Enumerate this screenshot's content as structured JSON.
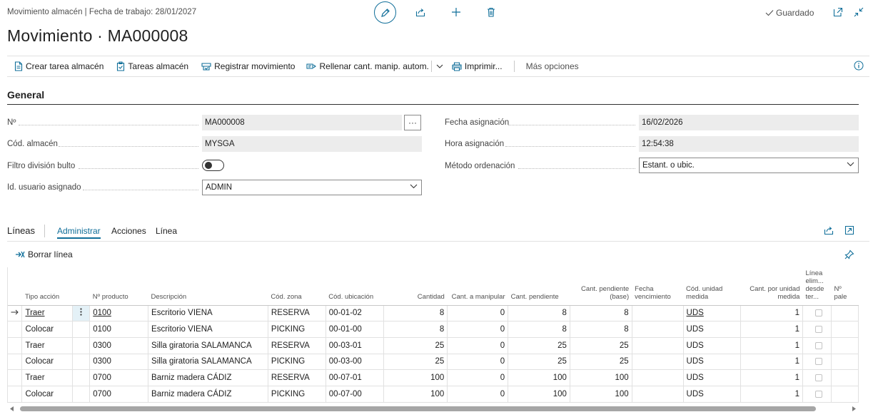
{
  "header": {
    "breadcrumb": "Movimiento almacén | Fecha de trabajo: 28/01/2027",
    "title": "Movimiento · MA000008",
    "saved_label": "Guardado"
  },
  "actions": {
    "create_task": "Crear tarea almacén",
    "tasks": "Tareas almacén",
    "register": "Registrar movimiento",
    "autofill": "Rellenar cant. manip. autom.",
    "print": "Imprimir...",
    "more": "Más opciones"
  },
  "general": {
    "title": "General",
    "no_label": "Nº",
    "no_value": "MA000008",
    "location_label": "Cód. almacén",
    "location_value": "MYSGA",
    "breakbulk_label": "Filtro división bulto",
    "breakbulk_value": false,
    "user_label": "Id. usuario asignado",
    "user_value": "ADMIN",
    "assign_date_label": "Fecha asignación",
    "assign_date_value": "16/02/2026",
    "assign_time_label": "Hora asignación",
    "assign_time_value": "12:54:38",
    "sort_label": "Método ordenación",
    "sort_value": "Estant. o ubic.",
    "assist_label": "···"
  },
  "lines": {
    "title": "Líneas",
    "tabs": [
      "Administrar",
      "Acciones",
      "Línea"
    ],
    "delete_label": "Borrar línea",
    "columns": {
      "action_type": "Tipo acción",
      "item_no": "Nº producto",
      "description": "Descripción",
      "zone": "Cód. zona",
      "bin": "Cód. ubicación",
      "qty": "Cantidad",
      "qty_handle": "Cant. a manipular",
      "qty_outstanding": "Cant. pendiente",
      "qty_outstanding_base": "Cant. pendiente (base)",
      "expiration": "Fecha vencimiento",
      "uom": "Cód. unidad medida",
      "qty_per_uom": "Cant. por unidad medida",
      "breakbulk_line": "Línea elim... desde ter...",
      "pallet": "Nº pale"
    },
    "rows": [
      {
        "action_type": "Traer",
        "item_no": "0100",
        "description": "Escritorio VIENA",
        "zone": "RESERVA",
        "bin": "00-01-02",
        "qty": "8",
        "qty_handle": "0",
        "qty_outstanding": "8",
        "qty_outstanding_base": "8",
        "uom": "UDS",
        "qty_per_uom": "1"
      },
      {
        "action_type": "Colocar",
        "item_no": "0100",
        "description": "Escritorio VIENA",
        "zone": "PICKING",
        "bin": "00-01-00",
        "qty": "8",
        "qty_handle": "0",
        "qty_outstanding": "8",
        "qty_outstanding_base": "8",
        "uom": "UDS",
        "qty_per_uom": "1"
      },
      {
        "action_type": "Traer",
        "item_no": "0300",
        "description": "Silla giratoria SALAMANCA",
        "zone": "RESERVA",
        "bin": "00-03-01",
        "qty": "25",
        "qty_handle": "0",
        "qty_outstanding": "25",
        "qty_outstanding_base": "25",
        "uom": "UDS",
        "qty_per_uom": "1"
      },
      {
        "action_type": "Colocar",
        "item_no": "0300",
        "description": "Silla giratoria SALAMANCA",
        "zone": "PICKING",
        "bin": "00-03-00",
        "qty": "25",
        "qty_handle": "0",
        "qty_outstanding": "25",
        "qty_outstanding_base": "25",
        "uom": "UDS",
        "qty_per_uom": "1"
      },
      {
        "action_type": "Traer",
        "item_no": "0700",
        "description": "Barniz madera CÁDIZ",
        "zone": "RESERVA",
        "bin": "00-07-01",
        "qty": "100",
        "qty_handle": "0",
        "qty_outstanding": "100",
        "qty_outstanding_base": "100",
        "uom": "UDS",
        "qty_per_uom": "1"
      },
      {
        "action_type": "Colocar",
        "item_no": "0700",
        "description": "Barniz madera CÁDIZ",
        "zone": "PICKING",
        "bin": "00-07-00",
        "qty": "100",
        "qty_handle": "0",
        "qty_outstanding": "100",
        "qty_outstanding_base": "100",
        "uom": "UDS",
        "qty_per_uom": "1"
      }
    ]
  },
  "colors": {
    "accent": "#0f6e99",
    "field_bg": "#ececec",
    "selected_cell": "#e4f1f7"
  }
}
